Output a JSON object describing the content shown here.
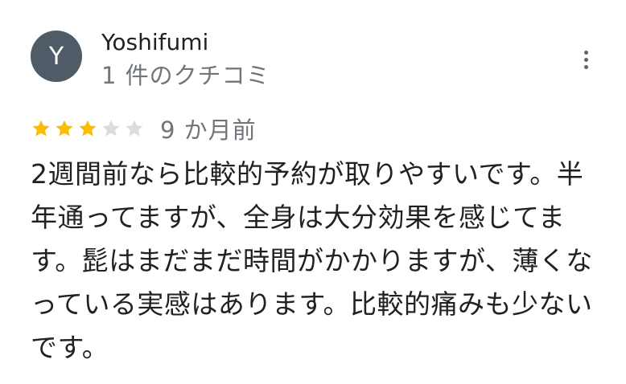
{
  "review": {
    "author": {
      "initial": "Y",
      "name": "Yoshifumi",
      "review_count_text": "1 件のクチコミ",
      "avatar_color": "#4f5b66"
    },
    "more_icon": "more-vert-icon",
    "rating": {
      "value": 3,
      "max": 5,
      "star_icon": "star-icon",
      "filled_color": "#fbbc04",
      "empty_color": "#dadce0"
    },
    "time_ago": "9 か月前",
    "text": "2週間前なら比較的予約が取りやすいです。半年通ってますが、全身は大分効果を感じてます。髭はまだまだ時間がかかりますが、薄くなっている実感はあります。比較的痛みも少ないです。"
  }
}
